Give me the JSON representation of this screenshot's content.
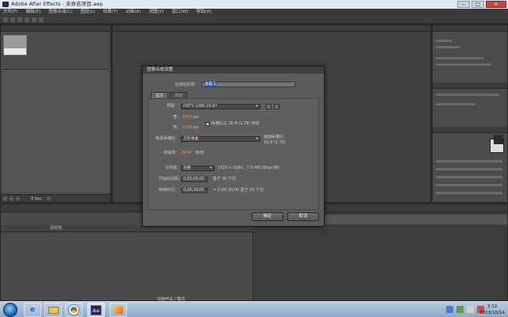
{
  "window": {
    "title": "Adobe After Effects - 未命名项目.aep",
    "minimize_glyph": "–",
    "maximize_glyph": "□",
    "close_glyph": "✕"
  },
  "menubar": {
    "items": [
      "文件(F)",
      "编辑(E)",
      "图像合成(C)",
      "图层(L)",
      "效果(T)",
      "动画(A)",
      "视图(V)",
      "窗口(W)",
      "帮助(H)"
    ]
  },
  "project_panel": {
    "bpc": "8 bpc"
  },
  "dialog": {
    "title": "图像合成设置",
    "comp_name_label": "合成组名称：",
    "comp_name_value": "合成 1",
    "tabs": [
      "基本",
      "高级"
    ],
    "preset_label": "预置：",
    "preset_value": "HDTV 1080 29.97",
    "width_label": "宽：",
    "width_value": "1920",
    "width_unit": "px",
    "height_label": "高：",
    "height_value": "1080",
    "height_unit": "px",
    "lock_aspect_label": "纵横比以 16:9 (1.78) 锁定",
    "pixel_aspect_label": "像素纵横比：",
    "pixel_aspect_value": "方形像素",
    "frame_aspect_label": "画面纵横比：",
    "frame_aspect_value": "16:9 (1.78)",
    "frame_rate_label": "帧速率：",
    "frame_rate_value": "29.97",
    "frame_rate_unit": "帧/秒",
    "resolution_label": "分辨率：",
    "resolution_value": "完整",
    "resolution_info": "1920 x 1080，7.9 MB (8bpc/帧)",
    "start_tc_label": "开始时间码：",
    "start_tc_value": "0;00;00;00",
    "start_tc_info": "基于 30 下拉",
    "duration_label": "持续时间：",
    "duration_value": "0;00;30;00",
    "duration_info": "= 0;00;30;00  基于 30 下拉",
    "ok_label": "确定",
    "cancel_label": "取消"
  },
  "timeline": {
    "col_name": "源名称",
    "switch_label": "切换开关 / 模式"
  },
  "taskbar": {
    "ae_icon_text": "Ae",
    "clock_time": "3:12",
    "clock_date": "2013/10/14"
  },
  "colors": {
    "accent": "#e49b3a",
    "selection": "#3569b6",
    "panel": "#4b4b4b",
    "taskbar": "#9fb7d2"
  }
}
